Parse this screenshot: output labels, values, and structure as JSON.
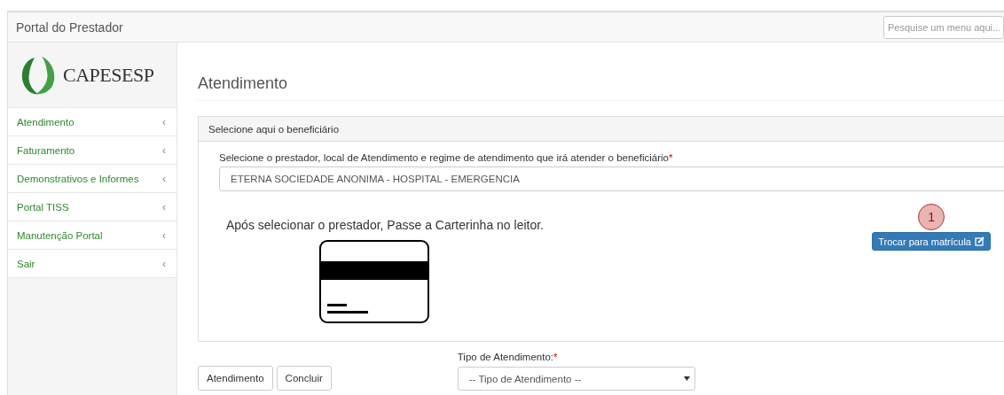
{
  "top_bar": {
    "title": "Portal do Prestador",
    "search": {
      "placeholder": "Pesquise um menu aqui..."
    }
  },
  "logo": {
    "text": "CAPESESP"
  },
  "sidebar": {
    "items": [
      {
        "label": "Atendimento",
        "chevron": "‹"
      },
      {
        "label": "Faturamento",
        "chevron": "‹"
      },
      {
        "label": "Demonstrativos e Informes",
        "chevron": "‹"
      },
      {
        "label": "Portal TISS",
        "chevron": "‹"
      },
      {
        "label": "Manutenção Portal",
        "chevron": "‹"
      },
      {
        "label": "Sair",
        "chevron": "‹"
      }
    ]
  },
  "page": {
    "heading": "Atendimento",
    "panel": {
      "title": "Selecione aqui o beneficiário",
      "provider_field": {
        "label": "Selecione o prestador, local de Atendimento e regime de atendimento que irá atender o beneficiário",
        "required_mark": "*",
        "value": "ETERNA SOCIEDADE ANONIMA - HOSPITAL - EMERGENCIA"
      },
      "instruction": "Após selecionar o prestador, Passe a Carterinha no leitor.",
      "annotation_badge": "1",
      "switch_button": "Trocar para matrícula"
    },
    "buttons": [
      "Atendimento",
      "Concluir"
    ],
    "type_field": {
      "label": "Tipo de Atendimento:",
      "required_mark": "*",
      "value": "-- Tipo de Atendimento --"
    }
  }
}
